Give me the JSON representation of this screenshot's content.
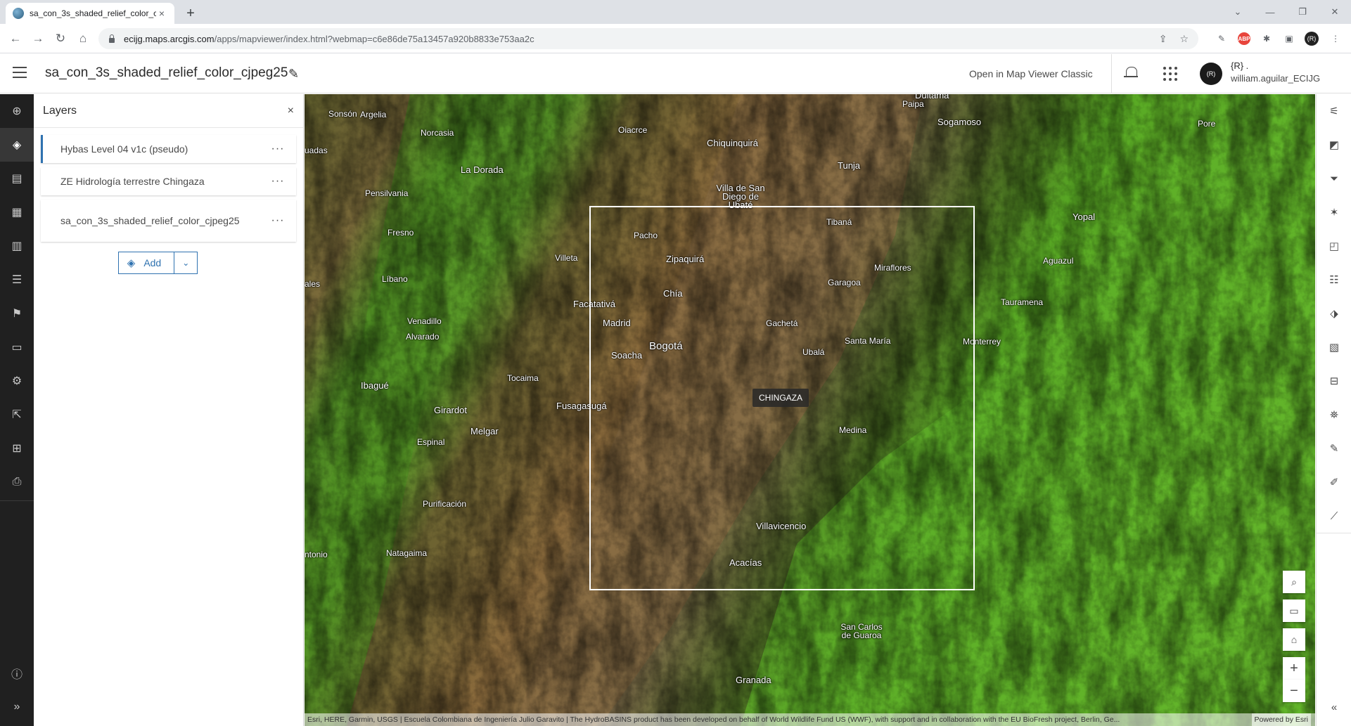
{
  "browser": {
    "tab_title": "sa_con_3s_shaded_relief_color_cj",
    "tab_close": "×",
    "new_tab": "+",
    "url_host": "ecijg.maps.arcgis.com",
    "url_path": "/apps/mapviewer/index.html?webmap=c6e86de75a13457a920b8833e753aa2c",
    "ext_abp": "ABP",
    "ext_profile": "(R)"
  },
  "header": {
    "map_title": "sa_con_3s_shaded_relief_color_cjpeg25",
    "open_classic": "Open in Map Viewer Classic",
    "avatar_text": "(R)",
    "user_display": "{R} .",
    "user_handle": "william.aguilar_ECIJG"
  },
  "panel": {
    "title": "Layers",
    "close": "×",
    "layers": [
      {
        "name": "Hybas Level 04 v1c (pseudo)",
        "more": "···"
      },
      {
        "name": "ZE Hidrología terrestre Chingaza",
        "more": "···"
      },
      {
        "name": "sa_con_3s_shaded_relief_color_cjpeg25",
        "more": "···"
      }
    ],
    "add_label": "Add"
  },
  "map": {
    "popup_label": "CHINGAZA",
    "attribution": "Esri, HERE, Garmin, USGS | Escuela Colombiana de Ingeniería Julio Garavito | The HydroBASINS product has been developed on behalf of World Wildlife Fund US (WWF), with support and in collaboration with the EU BioFresh project, Berlin, Ge...",
    "powered_by": "Powered by Esri",
    "places": [
      "Sonsón",
      "Argelia",
      "Norcasia",
      "La Dorada",
      "Pensilvania",
      "Fresno",
      "Líbano",
      "Venadillo",
      "Alvarado",
      "Ibagué",
      "Girardot",
      "Tocaima",
      "Espinal",
      "Melgar",
      "Purificación",
      "Natagaima",
      "Villeta",
      "Facatativá",
      "Madrid",
      "Bogotá",
      "Soacha",
      "Fusagasugá",
      "Zipaquirá",
      "Chía",
      "Pacho",
      "Villa de San Diego de Ubaté",
      "Oiacrce",
      "Chiquinquirá",
      "Tunja",
      "Sogamoso",
      "Duitama",
      "Paipa",
      "Tibaná",
      "Garagoa",
      "Miraflores",
      "Gachetá",
      "Ubalá",
      "Santa María",
      "Medina",
      "Villavicencio",
      "Acacías",
      "Granada",
      "San Carlos de Guaroa",
      "Yopal",
      "Aguazul",
      "Tauramena",
      "Monterrey",
      "Pore",
      "ales",
      "uadas",
      "ntonio"
    ]
  }
}
